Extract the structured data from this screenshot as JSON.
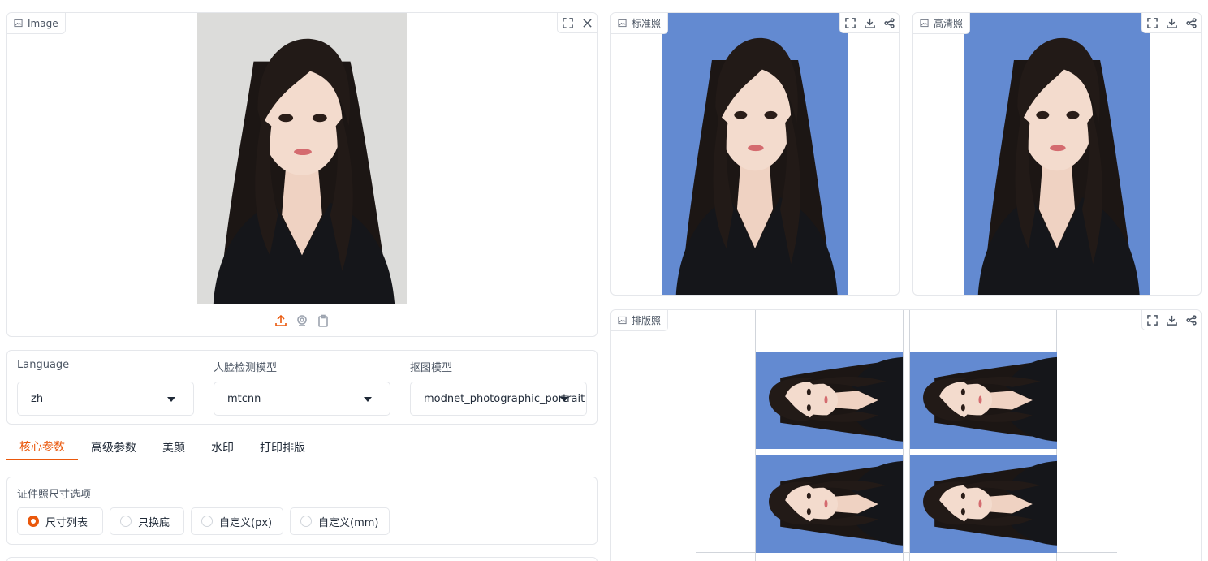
{
  "input_image": {
    "label": "Image"
  },
  "standard_photo": {
    "label": "标准照"
  },
  "hd_photo": {
    "label": "高清照"
  },
  "layout_photo": {
    "label": "排版照"
  },
  "settings": {
    "language": {
      "label": "Language",
      "value": "zh"
    },
    "face_model": {
      "label": "人脸检测模型",
      "value": "mtcnn"
    },
    "matting_model": {
      "label": "抠图模型",
      "value": "modnet_photographic_portrait"
    }
  },
  "tabs": [
    {
      "label": "核心参数",
      "active": true
    },
    {
      "label": "高级参数",
      "active": false
    },
    {
      "label": "美颜",
      "active": false
    },
    {
      "label": "水印",
      "active": false
    },
    {
      "label": "打印排版",
      "active": false
    }
  ],
  "size_options": {
    "label": "证件照尺寸选项",
    "options": [
      {
        "label": "尺寸列表",
        "checked": true
      },
      {
        "label": "只换底",
        "checked": false
      },
      {
        "label": "自定义(px)",
        "checked": false
      },
      {
        "label": "自定义(mm)",
        "checked": false
      }
    ]
  },
  "colors": {
    "accent": "#ea580c",
    "id_background": "#638ad1",
    "studio_background": "#dcdcda"
  },
  "icons": [
    "image-icon",
    "fullscreen-icon",
    "close-icon",
    "download-icon",
    "share-icon",
    "upload-icon",
    "webcam-icon",
    "clipboard-icon"
  ]
}
